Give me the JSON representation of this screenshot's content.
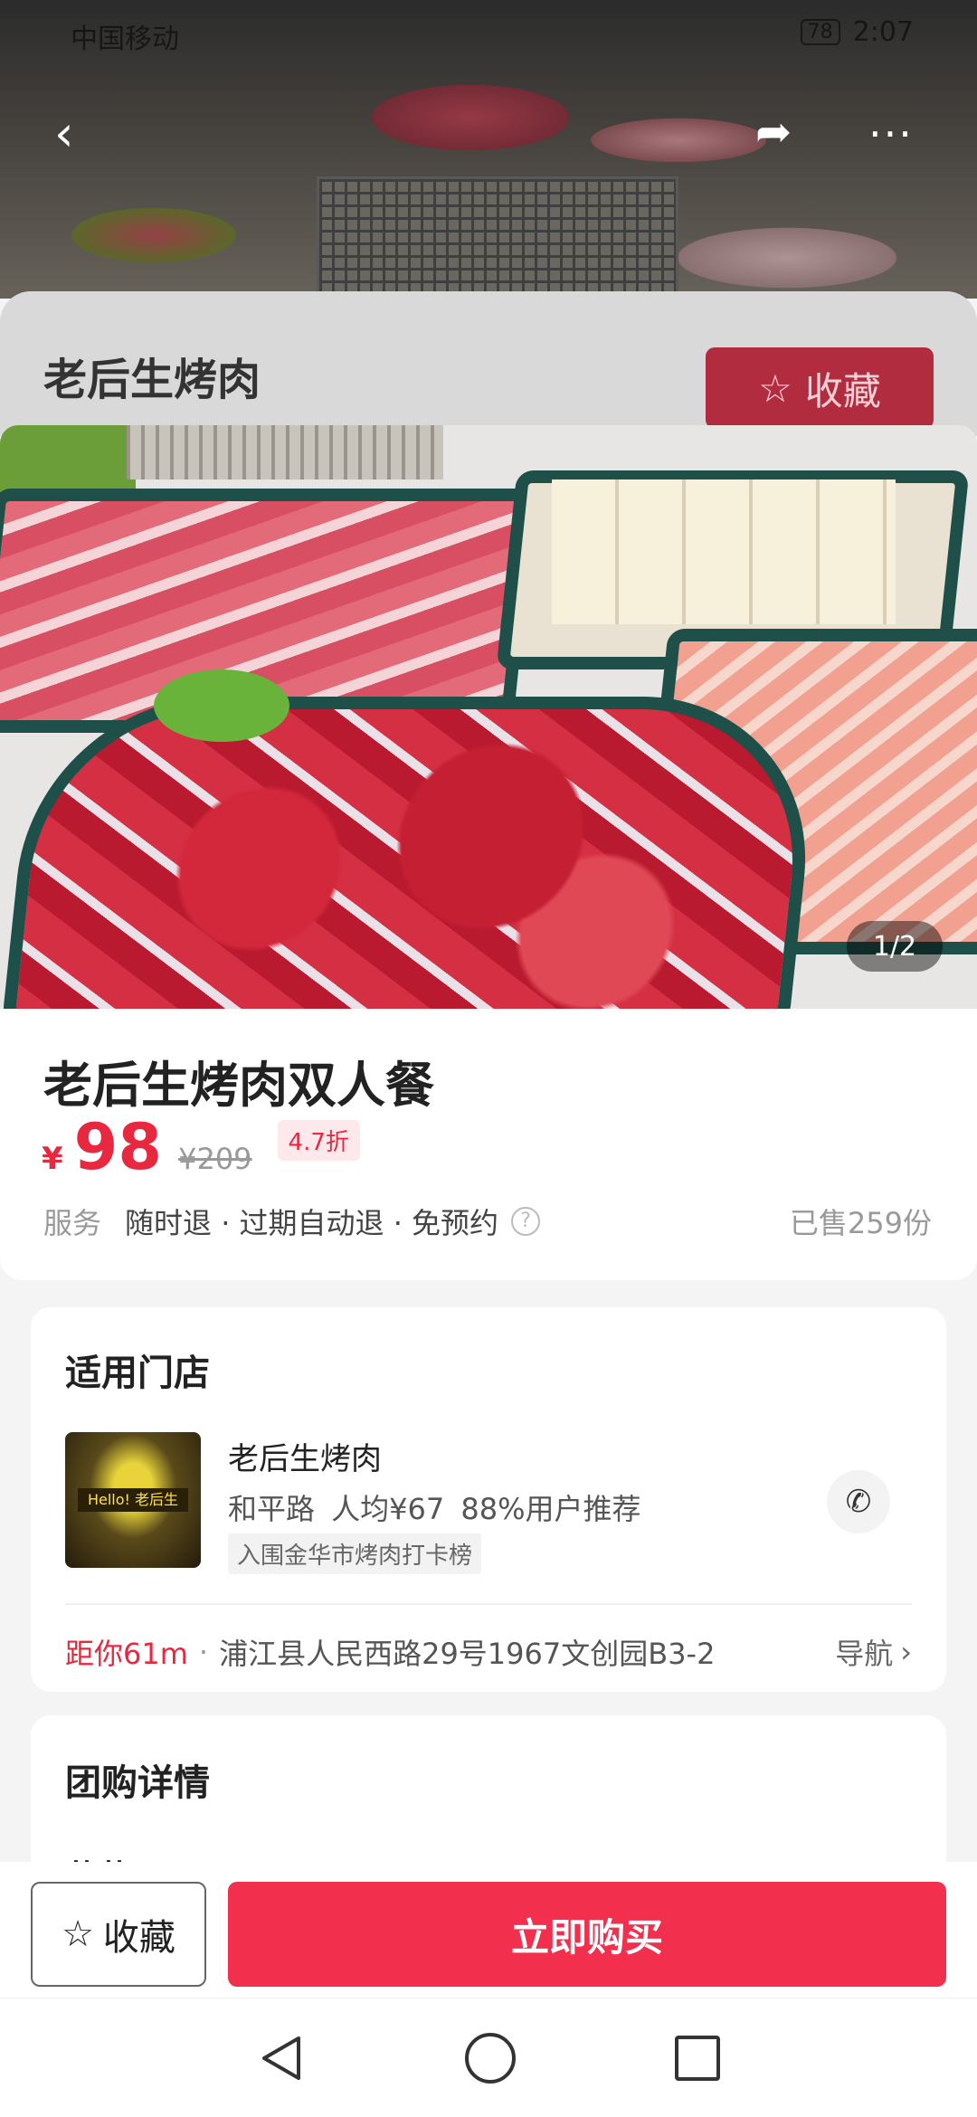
{
  "status_bar": {
    "carrier": "中国移动",
    "battery": "78",
    "time": "2:07"
  },
  "topbar": {
    "back_icon": "back-chevron-icon",
    "share_icon": "share-icon",
    "more_icon": "more-icon"
  },
  "shop_sheet": {
    "title": "老后生烤肉",
    "favorite_label": "收藏"
  },
  "hero": {
    "pager": "1/2"
  },
  "product": {
    "title": "老后生烤肉双人餐",
    "currency": "¥",
    "price": "98",
    "original_price": "¥209",
    "discount": "4.7折",
    "service_label": "服务",
    "services": "随时退 · 过期自动退 · 免预约",
    "sold": "已售259份"
  },
  "store": {
    "section_title": "适用门店",
    "name": "老后生烤肉",
    "meta": "和平路  人均¥67  88%用户推荐",
    "tag": "入围金华市烤肉打卡榜",
    "thumb_sign": "Hello! 老后生",
    "distance": "距你61m",
    "separator": "·",
    "address": "浦江县人民西路29号1967文创园B3-2",
    "nav_label": "导航"
  },
  "details": {
    "section_title": "团购详情",
    "partial_text": "菜菜"
  },
  "actions": {
    "favorite_label": "收藏",
    "buy_label": "立即购买"
  },
  "colors": {
    "accent": "#f2304e",
    "price": "#e8283e"
  }
}
